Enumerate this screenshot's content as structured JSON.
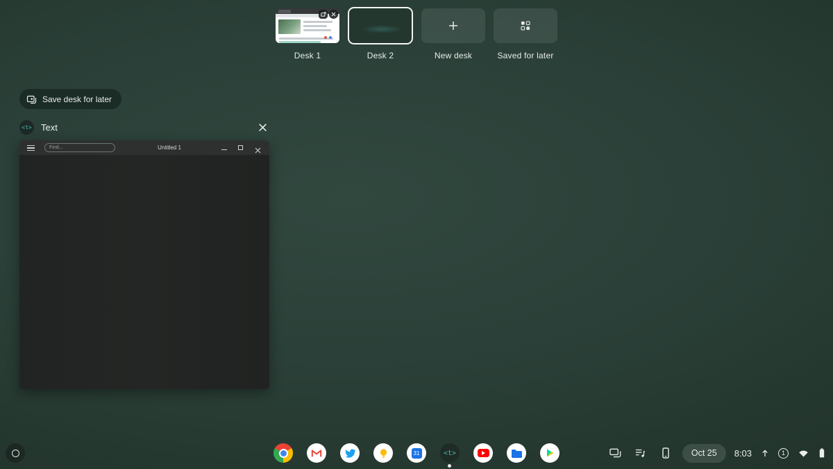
{
  "colors": {
    "accent_teal": "#4db6ac",
    "background_teal": "#2a3f37",
    "text_light": "#e9eeec",
    "selected_desk_border": "#f2f6f4"
  },
  "desk_bar": {
    "desks": [
      {
        "name": "Desk 1",
        "active": false
      },
      {
        "name": "Desk 2",
        "active": true
      }
    ],
    "new_desk_label": "New desk",
    "saved_for_later_label": "Saved for later"
  },
  "overview": {
    "save_desk_button_label": "Save desk for later",
    "window": {
      "app_badge": "<t>",
      "app_title": "Text",
      "editor": {
        "find_placeholder": "Find...",
        "document_title": "Untitled 1"
      }
    }
  },
  "shelf": {
    "apps": [
      "chrome",
      "gmail",
      "twitter",
      "keep",
      "calendar",
      "text",
      "youtube",
      "files",
      "play-store"
    ],
    "text_app_glyph": "<t>",
    "calendar_day": "31",
    "status": {
      "date": "Oct 25",
      "time": "8:03",
      "notification_count": "1"
    }
  }
}
